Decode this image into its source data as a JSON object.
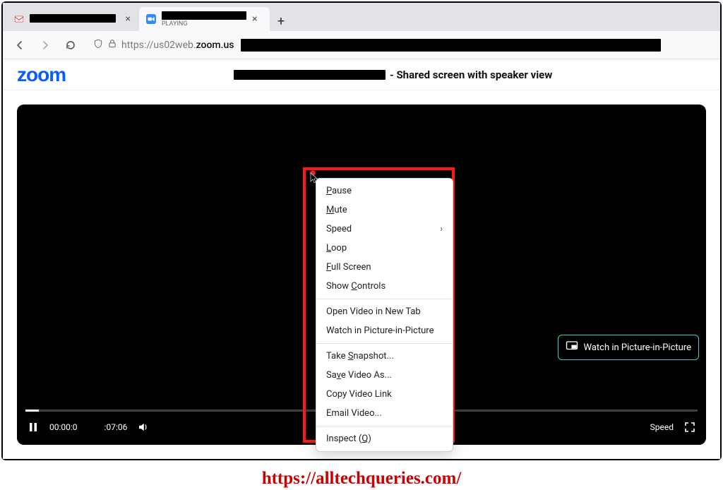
{
  "browser": {
    "tabs": [
      {
        "icon": "gmail",
        "redactWidth": 122
      },
      {
        "icon": "zoom",
        "redactWidth": 120,
        "sub": "PLAYING"
      }
    ],
    "nav": {
      "back": "←",
      "forward": "→",
      "reload": "↻"
    },
    "url": {
      "scheme": "https://",
      "domain_pre": "us02web.",
      "domain": "zoom.us",
      "rest_redactWidth": 595
    }
  },
  "page": {
    "logo": "zoom",
    "title_redactWidth": 215,
    "title_suffix": "- Shared screen with speaker view"
  },
  "video": {
    "time_current_prefix": "00:00:0",
    "time_total_suffix": ":07:06",
    "speed_label": "Speed"
  },
  "pip": {
    "label": "Watch in Picture-in-Picture"
  },
  "context_menu": {
    "sections": [
      [
        "Pause",
        "Mute",
        "Speed",
        "Loop",
        "Full Screen",
        "Show Controls"
      ],
      [
        "Open Video in New Tab",
        "Watch in Picture-in-Picture"
      ],
      [
        "Take Snapshot...",
        "Save Video As...",
        "Copy Video Link",
        "Email Video..."
      ],
      [
        "Inspect (Q)"
      ]
    ],
    "underlines": {
      "Pause": 0,
      "Mute": 0,
      "Loop": 0,
      "Full Screen": 0,
      "Show Controls": 5,
      "Take Snapshot...": 5,
      "Save Video As...": 2,
      "Inspect (Q)": 9
    },
    "submenu": [
      "Speed"
    ]
  },
  "watermark": "https://alltechqueries.com/"
}
